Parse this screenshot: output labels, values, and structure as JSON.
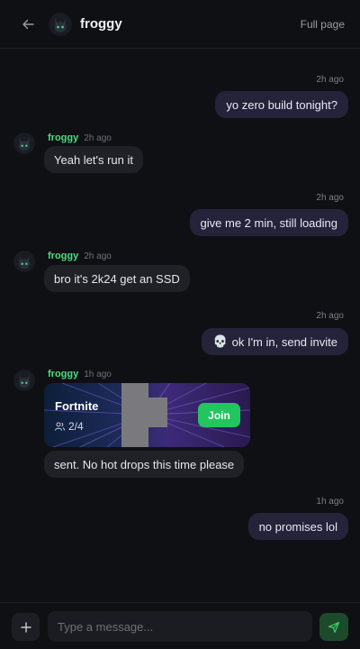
{
  "header": {
    "name": "froggy",
    "full_page_label": "Full page"
  },
  "messages": [
    {
      "direction": "out",
      "time": "2h ago",
      "text": "yo zero build tonight?"
    },
    {
      "direction": "in",
      "sender": "froggy",
      "time": "2h ago",
      "text": "Yeah let's run it"
    },
    {
      "direction": "out",
      "time": "2h ago",
      "text": "give me 2 min, still loading"
    },
    {
      "direction": "in",
      "sender": "froggy",
      "time": "2h ago",
      "text": "bro it's 2k24 get an SSD"
    },
    {
      "direction": "out",
      "time": "2h ago",
      "text": "ok I'm in, send invite",
      "emoji": "💀"
    },
    {
      "direction": "in",
      "sender": "froggy",
      "time": "1h ago",
      "text": "sent. No hot drops this time please",
      "invite": {
        "game": "Fortnite",
        "players": "2/4",
        "join_label": "Join"
      }
    },
    {
      "direction": "out",
      "time": "1h ago",
      "text": "no promises lol"
    }
  ],
  "composer": {
    "placeholder": "Type a message..."
  },
  "colors": {
    "background": "#0f1014",
    "outgoing_bubble": "#25233a",
    "incoming_bubble": "#202126",
    "sender_name": "#4ade80",
    "join_button": "#22c55e"
  },
  "icons": {
    "back": "arrow-left-icon",
    "avatar": "bunny-avatar",
    "players": "users-icon",
    "add": "plus-icon",
    "send": "send-icon"
  }
}
